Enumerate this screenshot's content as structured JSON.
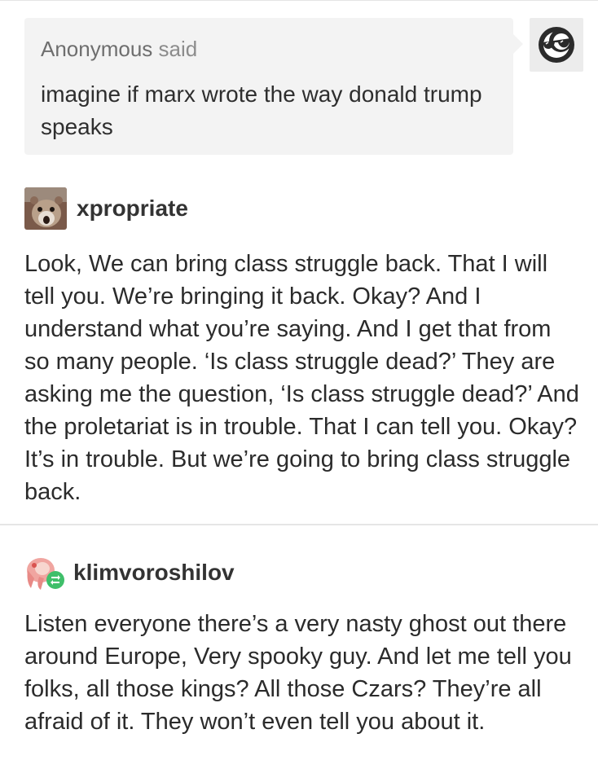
{
  "ask": {
    "asker": "Anonymous",
    "said": "said",
    "text": "imagine if marx wrote the way donald trump speaks",
    "avatar_icon": "anonymous-sunglasses-icon"
  },
  "posts": [
    {
      "username": "xpropriate",
      "avatar_icon": "hamster-avatar",
      "text": " Look, We can bring class struggle back. That I will tell you. We’re bringing it back. Okay? And I understand what you’re saying. And I get that from so many people. ‘Is class struggle dead?’ They are asking me the question, ‘Is class struggle dead?’ And the proletariat is in trouble. That I can tell you. Okay? It’s in trouble. But we’re going to bring class struggle back."
    },
    {
      "username": "klimvoroshilov",
      "avatar_icon": "anime-avatar",
      "reblog_icon": "reblog-icon",
      "text": "Listen everyone there’s a very nasty ghost out there around Europe, Very spooky guy. And let me tell you folks, all those kings? All those Czars? They’re all afraid of it. They won’t even tell you about it."
    }
  ],
  "colors": {
    "ask_bg": "#f3f3f3",
    "reblog_badge": "#3fbf6a"
  }
}
